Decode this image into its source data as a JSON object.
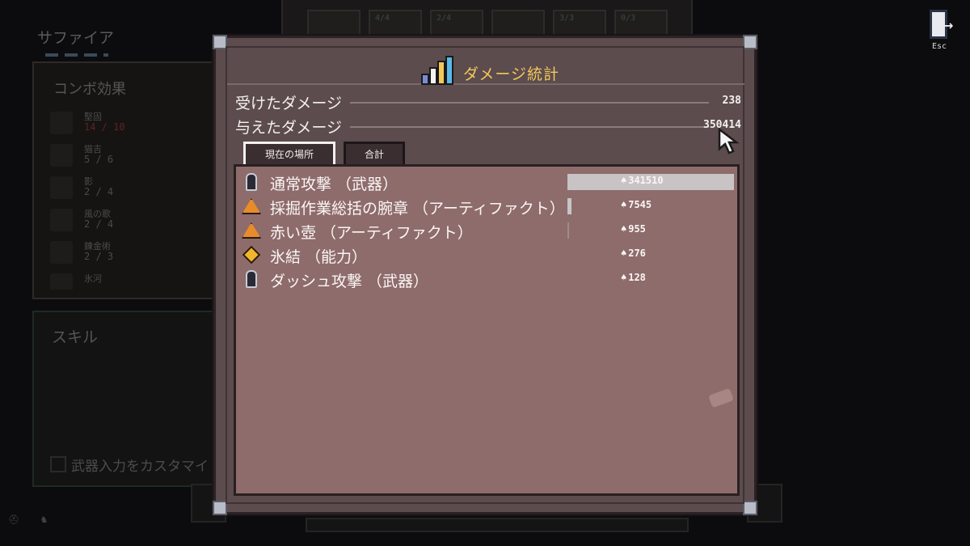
{
  "background": {
    "character_name": "サファイア",
    "toolbar_slots": [
      "",
      "4/4",
      "2/4",
      "",
      "3/3",
      "0/3"
    ],
    "combo": {
      "title": "コンボ効果",
      "items": [
        {
          "name": "堅固",
          "count": "14 / 10"
        },
        {
          "name": "猫吉",
          "count": "5 / 6"
        },
        {
          "name": "影",
          "count": "2 / 4"
        },
        {
          "name": "風の歌",
          "count": "2 / 4"
        },
        {
          "name": "錬金術",
          "count": "2 / 3"
        },
        {
          "name": "氷河",
          "count": ""
        }
      ]
    },
    "skill_title": "スキル",
    "customize_label": "武器入力をカスタマイ"
  },
  "esc_label": "Esc",
  "modal": {
    "title": "ダメージ統計",
    "received_label": "受けたダメージ",
    "received_value": "238",
    "dealt_label": "与えたダメージ",
    "dealt_value": "350414",
    "tabs": [
      "現在の場所",
      "合計"
    ],
    "rows": [
      {
        "icon": "weapon-icon",
        "label": "通常攻撃 （武器）",
        "value": "341510",
        "fraction": 1.0
      },
      {
        "icon": "artifact-icon",
        "label": "採掘作業総括の腕章 （アーティファクト）",
        "value": "7545",
        "fraction": 0.022
      },
      {
        "icon": "artifact-icon",
        "label": "赤い壺 （アーティファクト）",
        "value": "955",
        "fraction": 0.003
      },
      {
        "icon": "ability-icon",
        "label": "氷結 （能力）",
        "value": "276",
        "fraction": 0.0
      },
      {
        "icon": "weapon-icon",
        "label": "ダッシュ攻撃 （武器）",
        "value": "128",
        "fraction": 0.0
      }
    ]
  },
  "colors": {
    "title": "#f2c85a",
    "panel": "#8e6c6c",
    "modal": "#5c4c4e",
    "bar": "#c8c4c6"
  }
}
